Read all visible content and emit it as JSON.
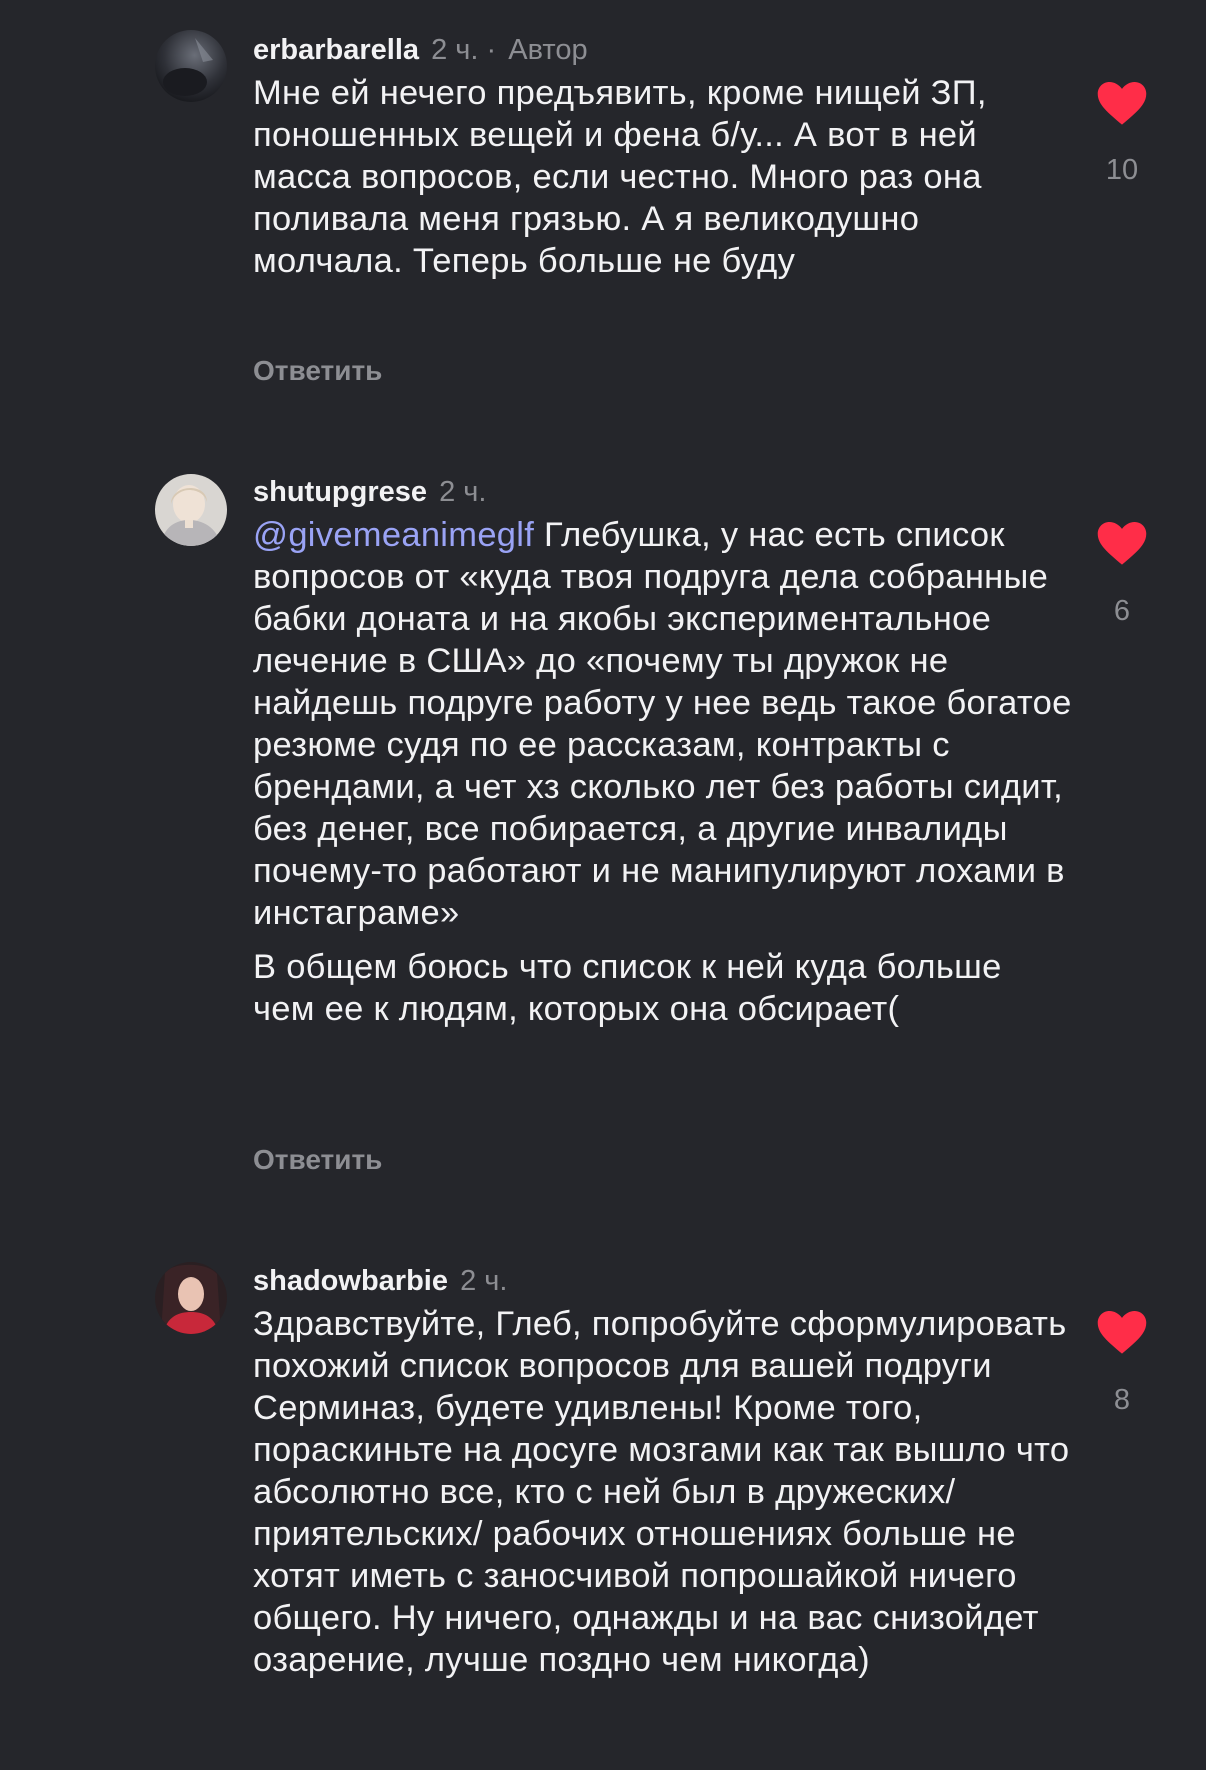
{
  "colors": {
    "background": "#25262b",
    "text": "#f2f2f4",
    "muted": "#8d8e93",
    "mention": "#9aa3f5",
    "heart": "#ff2d48"
  },
  "icons": {
    "like": "heart-icon"
  },
  "comments": [
    {
      "username": "erbarbarella",
      "time": "2 ч.",
      "author_separator": "·",
      "author_label": "Автор",
      "paragraphs": [
        "Мне ей нечего предъявить, кроме нищей ЗП, поношенных вещей и фена б/у... А вот в ней масса вопросов, если честно. Много раз она поливала меня грязью. А я великодушно молчала. Теперь больше не буду"
      ],
      "reply_label": "Ответить",
      "likes": "10"
    },
    {
      "username": "shutupgrese",
      "time": "2 ч.",
      "mention": "@givemeanimeglf",
      "paragraphs": [
        " Глебушка, у нас есть список вопросов от «куда твоя подруга дела собранные бабки доната и на якобы экспериментальное лечение в США» до «почему ты дружок не найдешь подруге работу у нее ведь такое богатое резюме судя по ее рассказам, контракты с брендами, а чет хз сколько лет без работы сидит, без денег, все побирается, а другие инвалиды почему-то работают и не манипулируют лохами в инстаграме»",
        "В общем боюсь что список к ней куда больше чем ее к людям, которых она обсирает("
      ],
      "reply_label": "Ответить",
      "likes": "6"
    },
    {
      "username": "shadowbarbie",
      "time": "2 ч.",
      "paragraphs": [
        "Здравствуйте, Глеб, попробуйте сформулировать похожий список вопросов для вашей подруги Серминаз, будете удивлены! Кроме того, пораскиньте на досуге мозгами как так вышло что абсолютно все, кто с ней был в дружеских/ приятельских/ рабочих отношениях больше не хотят иметь с заносчивой попрошайкой ничего общего. Ну ничего, однажды и на вас снизойдет озарение, лучше поздно чем никогда)"
      ],
      "likes": "8"
    }
  ]
}
